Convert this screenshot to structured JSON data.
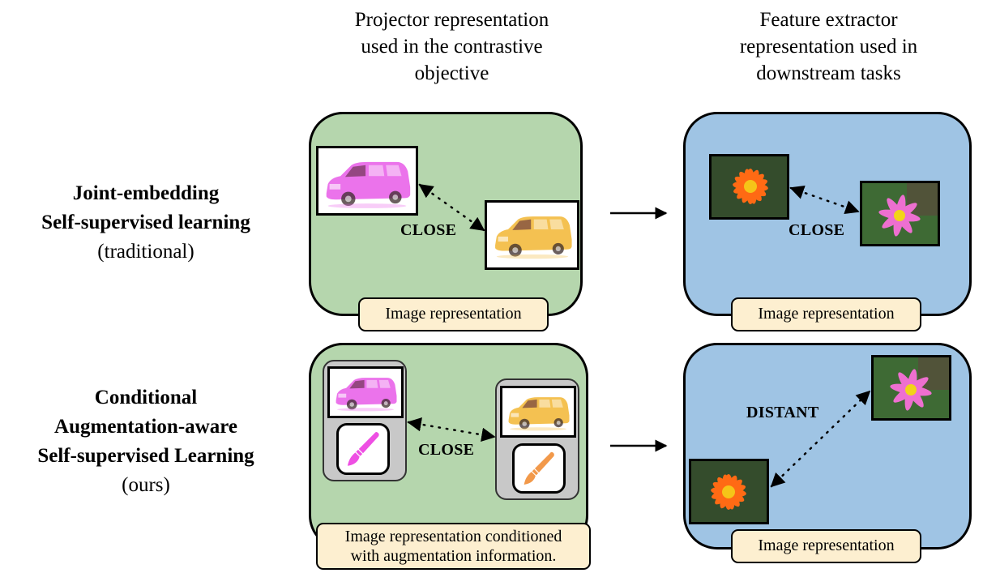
{
  "column_titles": {
    "projector": [
      "Projector representation",
      "used in the contrastive",
      "objective"
    ],
    "feature_extractor": [
      "Feature extractor",
      "representation used in",
      "downstream tasks"
    ]
  },
  "rows": {
    "traditional": {
      "title_lines": [
        "Joint-embedding",
        "Self-supervised learning"
      ],
      "subtitle": "(traditional)",
      "projector_panel": {
        "relation": "CLOSE",
        "caption": "Image representation",
        "images": [
          {
            "name": "minivan-pink",
            "tint": "#e85ae8"
          },
          {
            "name": "minivan-yellow",
            "tint": "#f2b632"
          }
        ]
      },
      "feature_panel": {
        "relation": "CLOSE",
        "caption": "Image representation",
        "images": [
          {
            "name": "orange-flower",
            "petal": "#ff6a14"
          },
          {
            "name": "pink-flower",
            "petal": "#ee6fd0"
          }
        ]
      }
    },
    "ours": {
      "title_lines": [
        "Conditional",
        "Augmentation-aware",
        "Self-supervised Learning"
      ],
      "subtitle": "(ours)",
      "projector_panel": {
        "relation": "CLOSE",
        "caption_lines": [
          "Image representation conditioned",
          "with augmentation information."
        ],
        "images": [
          {
            "name": "minivan-pink",
            "tint": "#e85ae8",
            "brush_color": "#ee4fe3"
          },
          {
            "name": "minivan-yellow",
            "tint": "#f2b632",
            "brush_color": "#f2994a"
          }
        ]
      },
      "feature_panel": {
        "relation": "DISTANT",
        "caption": "Image representation",
        "images": [
          {
            "name": "pink-flower",
            "petal": "#ee6fd0"
          },
          {
            "name": "orange-flower",
            "petal": "#ff6a14"
          }
        ]
      }
    }
  },
  "colors": {
    "projector_panel_bg": "#b5d6ad",
    "feature_panel_bg": "#9fc4e4",
    "caption_bg": "#fdefd0",
    "condition_box_bg": "#c8c8c8"
  }
}
